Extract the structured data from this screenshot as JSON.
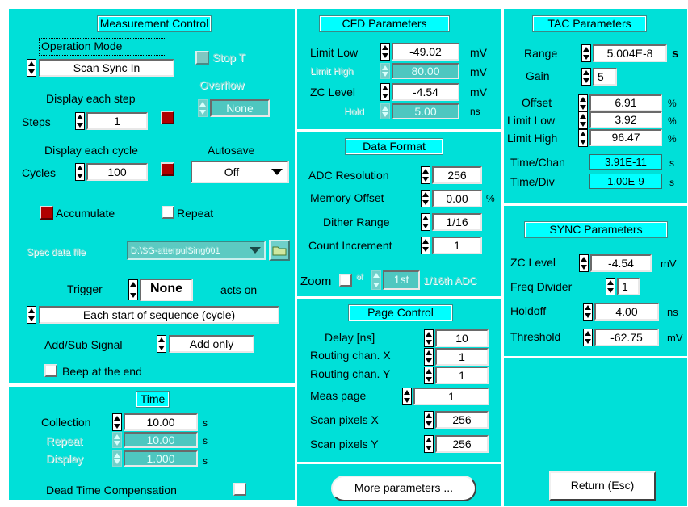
{
  "measurement_control": {
    "title": "Measurement Control",
    "operation_mode_label": "Operation Mode",
    "operation_mode_value": "Scan Sync In",
    "stop_t_label": "Stop T",
    "display_each_step": "Display each step",
    "overflow_label": "Overflow",
    "overflow_value": "None",
    "steps_label": "Steps",
    "steps_value": "1",
    "display_each_cycle": "Display each cycle",
    "autosave_label": "Autosave",
    "cycles_label": "Cycles",
    "cycles_value": "100",
    "autosave_value": "Off",
    "accumulate_label": "Accumulate",
    "repeat_label": "Repeat",
    "spec_data_file_label": "Spec data file",
    "spec_data_file_value": "D:\\SG-atterpulSing001",
    "trigger_label": "Trigger",
    "trigger_value": "None",
    "acts_on_label": "acts on",
    "acts_on_value": "Each start of sequence (cycle)",
    "add_sub_label": "Add/Sub Signal",
    "add_sub_value": "Add only",
    "beep_label": "Beep at the end"
  },
  "time": {
    "title": "Time",
    "collection_label": "Collection",
    "collection_value": "10.00",
    "repeat_label": "Repeat",
    "repeat_value": "10.00",
    "display_label": "Display",
    "display_value": "1.000",
    "unit": "s",
    "dead_time_label": "Dead Time Compensation"
  },
  "cfd": {
    "title": "CFD Parameters",
    "limit_low_label": "Limit Low",
    "limit_low_value": "-49.02",
    "limit_high_label": "Limit High",
    "limit_high_value": "80.00",
    "zc_level_label": "ZC Level",
    "zc_level_value": "-4.54",
    "hold_label": "Hold",
    "hold_value": "5.00",
    "unit_mv": "mV",
    "unit_ns": "ns"
  },
  "data_format": {
    "title": "Data Format",
    "adc_label": "ADC Resolution",
    "adc_value": "256",
    "memory_offset_label": "Memory Offset",
    "memory_offset_value": "0.00",
    "percent": "%",
    "dither_label": "Dither Range",
    "dither_value": "1/16",
    "count_inc_label": "Count Increment",
    "count_inc_value": "1",
    "zoom_label": "Zoom",
    "zoom_sub": "of",
    "zoom_value": "1st",
    "zoom_suffix": "1/16th ADC"
  },
  "page_control": {
    "title": "Page Control",
    "delay_label": "Delay [ns]",
    "delay_value": "10",
    "route_x_label": "Routing chan. X",
    "route_x_value": "1",
    "route_y_label": "Routing chan. Y",
    "route_y_value": "1",
    "meas_page_label": "Meas page",
    "meas_page_value": "1",
    "scan_x_label": "Scan pixels X",
    "scan_x_value": "256",
    "scan_y_label": "Scan pixels Y",
    "scan_y_value": "256"
  },
  "more_params_label": "More parameters ...",
  "tac": {
    "title": "TAC Parameters",
    "range_label": "Range",
    "range_value": "5.004E-8",
    "range_unit": "s",
    "gain_label": "Gain",
    "gain_value": "5",
    "offset_label": "Offset",
    "offset_value": "6.91",
    "limit_low_label": "Limit Low",
    "limit_low_value": "3.92",
    "limit_high_label": "Limit High",
    "limit_high_value": "96.47",
    "percent": "%",
    "time_chan_label": "Time/Chan",
    "time_chan_value": "3.91E-11",
    "time_div_label": "Time/Div",
    "time_div_value": "1.00E-9",
    "s": "s"
  },
  "sync": {
    "title": "SYNC Parameters",
    "zc_level_label": "ZC Level",
    "zc_level_value": "-4.54",
    "mv": "mV",
    "freq_div_label": "Freq Divider",
    "freq_div_value": "1",
    "holdoff_label": "Holdoff",
    "holdoff_value": "4.00",
    "ns": "ns",
    "threshold_label": "Threshold",
    "threshold_value": "-62.75"
  },
  "return_label": "Return (Esc)"
}
